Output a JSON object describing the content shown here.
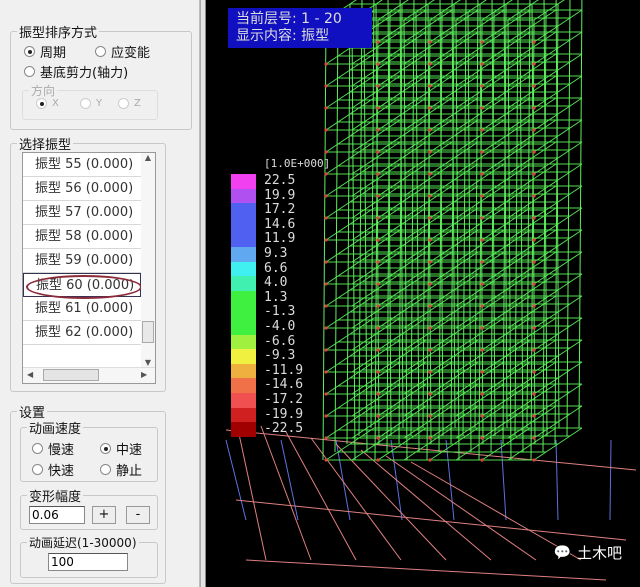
{
  "sort": {
    "title": "振型排序方式",
    "options": [
      {
        "label": "周期",
        "checked": true
      },
      {
        "label": "应变能",
        "checked": false
      },
      {
        "label": "基底剪力(轴力)",
        "checked": false
      }
    ],
    "direction": {
      "title": "方向",
      "options": [
        {
          "label": "X",
          "checked": true
        },
        {
          "label": "Y",
          "checked": false
        },
        {
          "label": "Z",
          "checked": false
        }
      ]
    }
  },
  "modes": {
    "title": "选择振型",
    "items": [
      "振型 55  (0.000)",
      "振型 56  (0.000)",
      "振型 57  (0.000)",
      "振型 58  (0.000)",
      "振型 59  (0.000)",
      "振型 60  (0.000)",
      "振型 61  (0.000)",
      "振型 62  (0.000)"
    ],
    "selected_index": 5
  },
  "settings": {
    "title": "设置",
    "speed": {
      "title": "动画速度",
      "options": [
        {
          "label": "慢速",
          "checked": false
        },
        {
          "label": "中速",
          "checked": true
        },
        {
          "label": "快速",
          "checked": false
        },
        {
          "label": "静止",
          "checked": false
        }
      ]
    },
    "amplitude": {
      "title": "变形幅度",
      "value": "0.06",
      "plus": "+",
      "minus": "-"
    },
    "delay": {
      "title": "动画延迟(1-30000)",
      "value": "100"
    }
  },
  "viewport": {
    "layer_label": "当前层号: 1 - 20",
    "content_label": "显示内容: 振型",
    "legend": {
      "unit": "[1.0E+000]",
      "labels": [
        "22.5",
        "19.9",
        "17.2",
        "14.6",
        "11.9",
        "9.3",
        "6.6",
        "4.0",
        "1.3",
        "-1.3",
        "-4.0",
        "-6.6",
        "-9.3",
        "-11.9",
        "-14.6",
        "-17.2",
        "-19.9",
        "-22.5"
      ],
      "colors": [
        "#f040f0",
        "#b050f0",
        "#5060f0",
        "#5060f0",
        "#5060f0",
        "#60a8f0",
        "#40f0f0",
        "#40f0b0",
        "#40f040",
        "#40f040",
        "#40f040",
        "#a0f040",
        "#f0f040",
        "#f0b040",
        "#f07048",
        "#f05050",
        "#d02020",
        "#a00000"
      ]
    }
  },
  "watermark": "土木吧"
}
